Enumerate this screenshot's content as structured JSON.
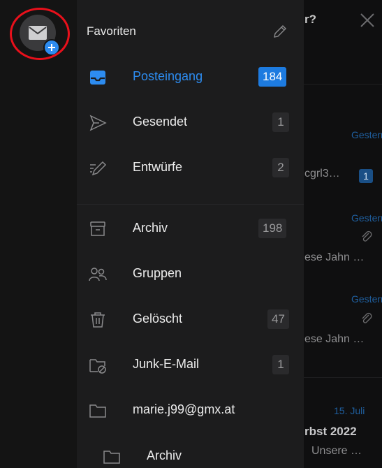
{
  "background_inbox": {
    "title_fragment": "r?",
    "items": [
      {
        "date": "Gestern",
        "preview": "cgrl3…",
        "badge": "1"
      },
      {
        "date": "Gestern",
        "preview": "ese Jahn …"
      },
      {
        "date": "Gestern",
        "preview": "ese Jahn …"
      },
      {
        "date": "15. Juli",
        "subject": "rbst 2022",
        "preview": "Unsere …"
      }
    ]
  },
  "drawer": {
    "section_title": "Favoriten",
    "folders": [
      {
        "label": "Posteingang",
        "count": "184",
        "icon": "inbox-icon",
        "active": true
      },
      {
        "label": "Gesendet",
        "count": "1",
        "icon": "send-icon"
      },
      {
        "label": "Entwürfe",
        "count": "2",
        "icon": "drafts-icon"
      },
      {
        "label": "Archiv",
        "count": "198",
        "icon": "archive-icon"
      },
      {
        "label": "Gruppen",
        "count": "",
        "icon": "groups-icon"
      },
      {
        "label": "Gelöscht",
        "count": "47",
        "icon": "trash-icon"
      },
      {
        "label": "Junk-E-Mail",
        "count": "1",
        "icon": "junk-folder-icon"
      },
      {
        "label": "marie.j99@gmx.at",
        "count": "",
        "icon": "folder-icon"
      },
      {
        "label": "Archiv",
        "count": "",
        "icon": "folder-icon"
      }
    ]
  },
  "colors": {
    "accent": "#2d8cf0",
    "drawer_bg": "#1c1c1d",
    "rail_bg": "#141414",
    "highlight_ring": "#e8101b"
  }
}
